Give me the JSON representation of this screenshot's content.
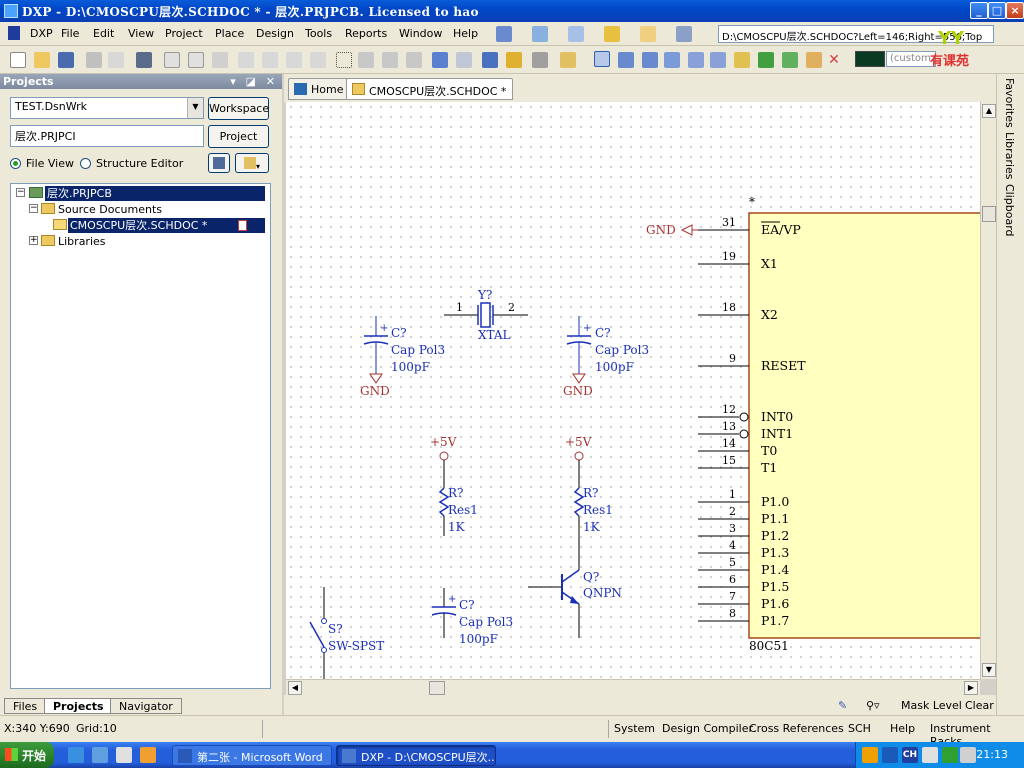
{
  "window": {
    "title": "DXP - D:\\CMOSCPU层次.SCHDOC * - 层次.PRJPCB. Licensed to hao",
    "buttons": [
      "_",
      "□",
      "×"
    ]
  },
  "menu": {
    "items": [
      "DXP",
      "File",
      "Edit",
      "View",
      "Project",
      "Place",
      "Design",
      "Tools",
      "Reports",
      "Window",
      "Help"
    ]
  },
  "pathbar": {
    "text": "D:\\CMOSCPU层次.SCHDOC?Left=146;Right=556;Top"
  },
  "brand": {
    "text": "有课苑",
    "mark": "YY"
  },
  "toolbar": {
    "color_placeholder": "(custom"
  },
  "projects_panel": {
    "title": "Projects",
    "workspace_value": "TEST.DsnWrk",
    "workspace_button": "Workspace",
    "project_value": "层次.PRJPCI",
    "project_button": "Project",
    "view_file": "File View",
    "view_structure": "Structure Editor",
    "tree": {
      "project": "层次.PRJPCB",
      "source_docs": "Source Documents",
      "document": "CMOSCPU层次.SCHDOC *",
      "libraries": "Libraries"
    },
    "tabs": [
      "Files",
      "Projects",
      "Navigator"
    ]
  },
  "doc_tabs": {
    "home": "Home",
    "active": "CMOSCPU层次.SCHDOC *"
  },
  "right_tabs": [
    "Favorites",
    "Libraries",
    "Clipboard"
  ],
  "editor_bottom": {
    "mask_level": "Mask Level",
    "clear": "Clear"
  },
  "status": {
    "coords": "X:340 Y:690",
    "grid": "Grid:10",
    "panels": [
      "System",
      "Design Compiler",
      "Cross References",
      "SCH",
      "Help",
      "Instrument Racks"
    ]
  },
  "taskbar": {
    "start": "开始",
    "tasks": [
      "第二张 - Microsoft Word",
      "DXP - D:\\CMOSCPU层次...."
    ],
    "clock": "21:13",
    "ime": "CH"
  },
  "schematic": {
    "ic": {
      "designator_marker": "*",
      "part": "80C51",
      "pins": [
        {
          "num": "31",
          "name": "EA/VP"
        },
        {
          "num": "19",
          "name": "X1"
        },
        {
          "num": "18",
          "name": "X2"
        },
        {
          "num": "9",
          "name": "RESET"
        },
        {
          "num": "12",
          "name": "INT0"
        },
        {
          "num": "13",
          "name": "INT1"
        },
        {
          "num": "14",
          "name": "T0"
        },
        {
          "num": "15",
          "name": "T1"
        },
        {
          "num": "1",
          "name": "P1.0"
        },
        {
          "num": "2",
          "name": "P1.1"
        },
        {
          "num": "3",
          "name": "P1.2"
        },
        {
          "num": "4",
          "name": "P1.3"
        },
        {
          "num": "5",
          "name": "P1.4"
        },
        {
          "num": "6",
          "name": "P1.5"
        },
        {
          "num": "7",
          "name": "P1.6"
        },
        {
          "num": "8",
          "name": "P1.7"
        }
      ]
    },
    "gnd_label": "GND",
    "vcc_label": "+5V",
    "crystal": {
      "ref": "Y?",
      "value": "XTAL",
      "pin1": "1",
      "pin2": "2"
    },
    "caps": [
      {
        "ref": "C?",
        "type": "Cap Pol3",
        "value": "100pF"
      },
      {
        "ref": "C?",
        "type": "Cap Pol3",
        "value": "100pF"
      },
      {
        "ref": "C?",
        "type": "Cap Pol3",
        "value": "100pF"
      }
    ],
    "resistors": [
      {
        "ref": "R?",
        "type": "Res1",
        "value": "1K"
      },
      {
        "ref": "R?",
        "type": "Res1",
        "value": "1K"
      }
    ],
    "transistor": {
      "ref": "Q?",
      "type": "QNPN"
    },
    "switch": {
      "ref": "S?",
      "type": "SW-SPST"
    }
  }
}
